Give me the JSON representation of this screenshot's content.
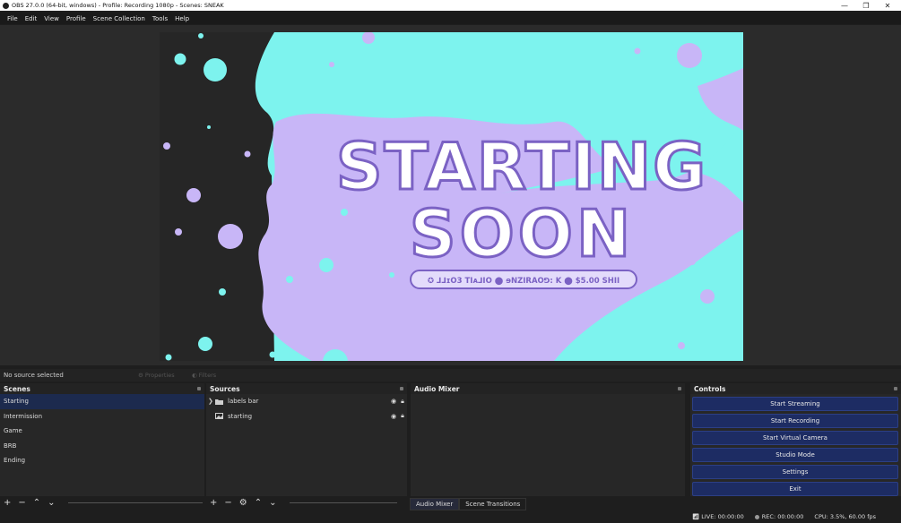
{
  "window": {
    "title": "OBS 27.0.0 (64-bit, windows) - Profile: Recording 1080p - Scenes: SNEAK",
    "minimize": "—",
    "maximize": "❐",
    "close": "✕"
  },
  "menu": [
    "File",
    "Edit",
    "View",
    "Profile",
    "Scene Collection",
    "Tools",
    "Help"
  ],
  "preview": {
    "line1": "STARTING",
    "line2": "SOON",
    "ticker": "✪ ⅃⅃ɪO3   TIᴀ⅃IO   ⬤ ɘNZIRAOꓨ: K ⬤   $5.00   SHII"
  },
  "source_toolbar": {
    "no_source": "No source selected",
    "properties": "Properties",
    "filters": "Filters"
  },
  "scenes": {
    "header": "Scenes",
    "items": [
      {
        "label": "Starting",
        "selected": true
      },
      {
        "label": "Intermission",
        "selected": false
      },
      {
        "label": "Game",
        "selected": false
      },
      {
        "label": "BRB",
        "selected": false
      },
      {
        "label": "Ending",
        "selected": false
      }
    ]
  },
  "sources": {
    "header": "Sources",
    "items": [
      {
        "label": "labels bar",
        "type": "folder-icon",
        "expandable": true
      },
      {
        "label": "starting",
        "type": "image-icon",
        "expandable": false
      }
    ]
  },
  "audio_mixer": {
    "header": "Audio Mixer"
  },
  "controls": {
    "header": "Controls",
    "buttons": [
      "Start Streaming",
      "Start Recording",
      "Start Virtual Camera",
      "Studio Mode",
      "Settings",
      "Exit"
    ]
  },
  "tabs": [
    {
      "label": "Audio Mixer",
      "active": true
    },
    {
      "label": "Scene Transitions",
      "active": false
    }
  ],
  "status": {
    "live": "LIVE: 00:00:00",
    "rec": "REC: 00:00:00",
    "cpu": "CPU: 3.5%, 60.00 fps"
  },
  "colors": {
    "mint": "#7df3ee",
    "lavender": "#c8b6f7",
    "accent_blue": "#1d2c63",
    "selected_row": "#1c2a4e"
  }
}
